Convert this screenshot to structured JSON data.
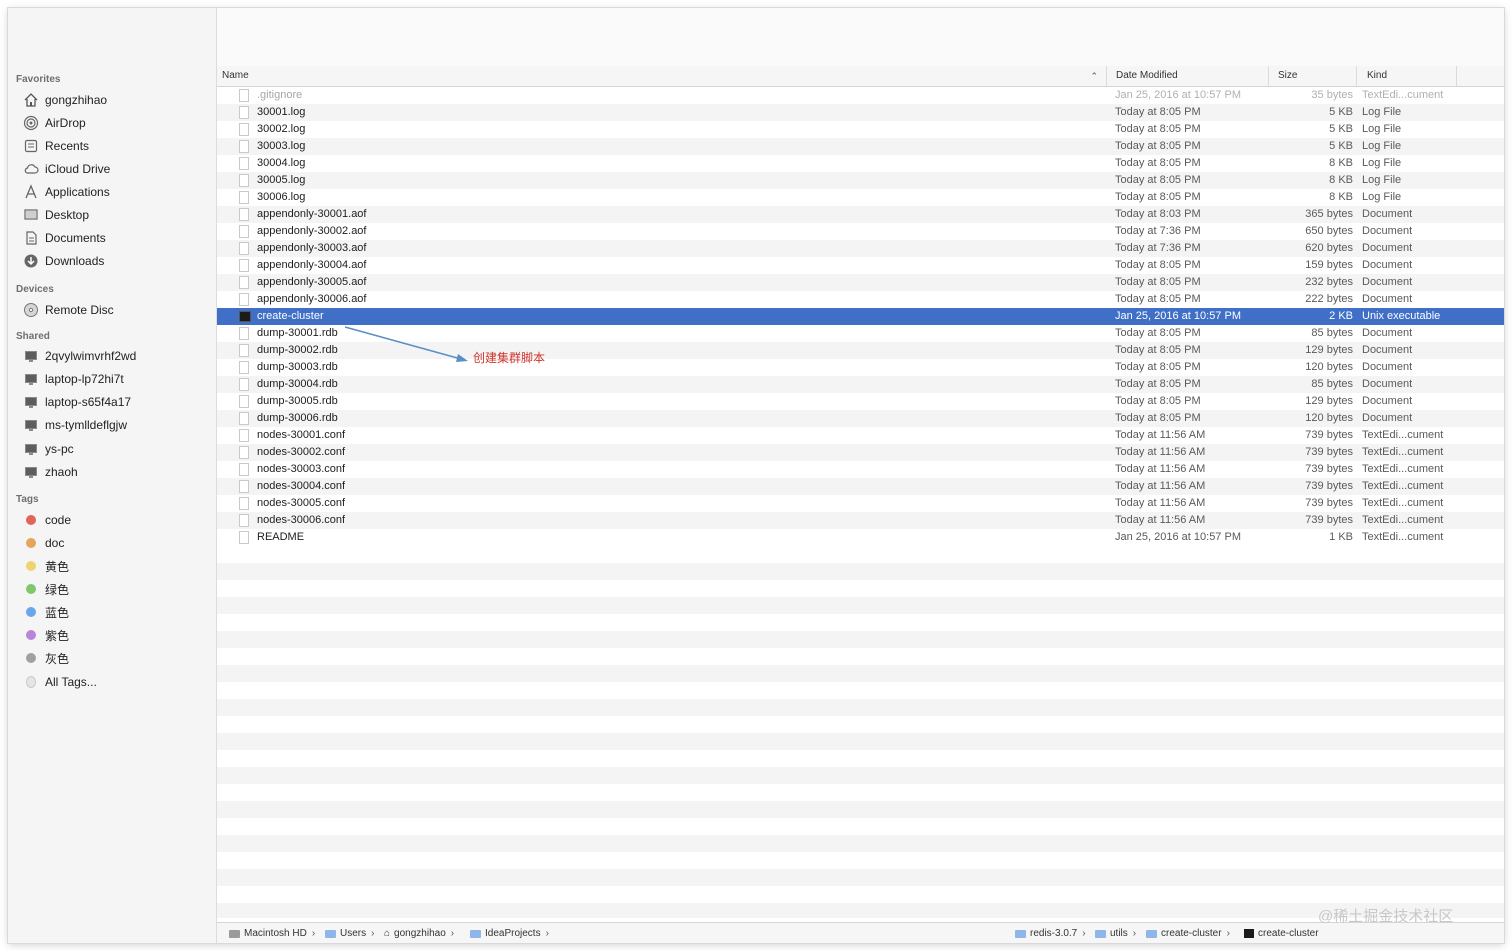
{
  "sidebar": {
    "sections": {
      "favorites": "Favorites",
      "devices": "Devices",
      "shared": "Shared",
      "tags": "Tags"
    },
    "favorites": [
      {
        "label": "gongzhihao",
        "icon": "home-icon"
      },
      {
        "label": "AirDrop",
        "icon": "airdrop-icon"
      },
      {
        "label": "Recents",
        "icon": "recents-icon"
      },
      {
        "label": "iCloud Drive",
        "icon": "cloud-icon"
      },
      {
        "label": "Applications",
        "icon": "applications-icon"
      },
      {
        "label": "Desktop",
        "icon": "desktop-icon"
      },
      {
        "label": "Documents",
        "icon": "documents-icon"
      },
      {
        "label": "Downloads",
        "icon": "downloads-icon"
      }
    ],
    "devices": [
      {
        "label": "Remote Disc",
        "icon": "disc-icon"
      }
    ],
    "shared": [
      {
        "label": "2qvylwimvrhf2wd",
        "icon": "computer-icon"
      },
      {
        "label": "laptop-lp72hi7t",
        "icon": "computer-icon"
      },
      {
        "label": "laptop-s65f4a17",
        "icon": "computer-icon"
      },
      {
        "label": "ms-tymlldeflgjw",
        "icon": "computer-icon"
      },
      {
        "label": "ys-pc",
        "icon": "computer-icon"
      },
      {
        "label": "zhaoh",
        "icon": "computer-icon"
      }
    ],
    "tags": [
      {
        "label": "code",
        "color": "#e0655c"
      },
      {
        "label": "doc",
        "color": "#e5a55b"
      },
      {
        "label": "黄色",
        "color": "#efd372"
      },
      {
        "label": "绿色",
        "color": "#7fc86a"
      },
      {
        "label": "蓝色",
        "color": "#69a7ea"
      },
      {
        "label": "紫色",
        "color": "#b985d9"
      },
      {
        "label": "灰色",
        "color": "#a0a0a0"
      },
      {
        "label": "All Tags...",
        "color": "#e5e5e5"
      }
    ]
  },
  "columns": {
    "name": "Name",
    "date": "Date Modified",
    "size": "Size",
    "kind": "Kind"
  },
  "files": [
    {
      "name": ".gitignore",
      "date": "Jan 25, 2016 at 10:57 PM",
      "size": "35 bytes",
      "kind": "TextEdi...cument",
      "state": "dim"
    },
    {
      "name": "30001.log",
      "date": "Today at 8:05 PM",
      "size": "5 KB",
      "kind": "Log File"
    },
    {
      "name": "30002.log",
      "date": "Today at 8:05 PM",
      "size": "5 KB",
      "kind": "Log File"
    },
    {
      "name": "30003.log",
      "date": "Today at 8:05 PM",
      "size": "5 KB",
      "kind": "Log File"
    },
    {
      "name": "30004.log",
      "date": "Today at 8:05 PM",
      "size": "8 KB",
      "kind": "Log File"
    },
    {
      "name": "30005.log",
      "date": "Today at 8:05 PM",
      "size": "8 KB",
      "kind": "Log File"
    },
    {
      "name": "30006.log",
      "date": "Today at 8:05 PM",
      "size": "8 KB",
      "kind": "Log File"
    },
    {
      "name": "appendonly-30001.aof",
      "date": "Today at 8:03 PM",
      "size": "365 bytes",
      "kind": "Document"
    },
    {
      "name": "appendonly-30002.aof",
      "date": "Today at 7:36 PM",
      "size": "650 bytes",
      "kind": "Document"
    },
    {
      "name": "appendonly-30003.aof",
      "date": "Today at 7:36 PM",
      "size": "620 bytes",
      "kind": "Document"
    },
    {
      "name": "appendonly-30004.aof",
      "date": "Today at 8:05 PM",
      "size": "159 bytes",
      "kind": "Document"
    },
    {
      "name": "appendonly-30005.aof",
      "date": "Today at 8:05 PM",
      "size": "232 bytes",
      "kind": "Document"
    },
    {
      "name": "appendonly-30006.aof",
      "date": "Today at 8:05 PM",
      "size": "222 bytes",
      "kind": "Document"
    },
    {
      "name": "create-cluster",
      "date": "Jan 25, 2016 at 10:57 PM",
      "size": "2 KB",
      "kind": "Unix executable",
      "state": "selected",
      "icon": "exe"
    },
    {
      "name": "dump-30001.rdb",
      "date": "Today at 8:05 PM",
      "size": "85 bytes",
      "kind": "Document"
    },
    {
      "name": "dump-30002.rdb",
      "date": "Today at 8:05 PM",
      "size": "129 bytes",
      "kind": "Document"
    },
    {
      "name": "dump-30003.rdb",
      "date": "Today at 8:05 PM",
      "size": "120 bytes",
      "kind": "Document"
    },
    {
      "name": "dump-30004.rdb",
      "date": "Today at 8:05 PM",
      "size": "85 bytes",
      "kind": "Document"
    },
    {
      "name": "dump-30005.rdb",
      "date": "Today at 8:05 PM",
      "size": "129 bytes",
      "kind": "Document"
    },
    {
      "name": "dump-30006.rdb",
      "date": "Today at 8:05 PM",
      "size": "120 bytes",
      "kind": "Document"
    },
    {
      "name": "nodes-30001.conf",
      "date": "Today at 11:56 AM",
      "size": "739 bytes",
      "kind": "TextEdi...cument"
    },
    {
      "name": "nodes-30002.conf",
      "date": "Today at 11:56 AM",
      "size": "739 bytes",
      "kind": "TextEdi...cument"
    },
    {
      "name": "nodes-30003.conf",
      "date": "Today at 11:56 AM",
      "size": "739 bytes",
      "kind": "TextEdi...cument"
    },
    {
      "name": "nodes-30004.conf",
      "date": "Today at 11:56 AM",
      "size": "739 bytes",
      "kind": "TextEdi...cument"
    },
    {
      "name": "nodes-30005.conf",
      "date": "Today at 11:56 AM",
      "size": "739 bytes",
      "kind": "TextEdi...cument"
    },
    {
      "name": "nodes-30006.conf",
      "date": "Today at 11:56 AM",
      "size": "739 bytes",
      "kind": "TextEdi...cument"
    },
    {
      "name": "README",
      "date": "Jan 25, 2016 at 10:57 PM",
      "size": "1 KB",
      "kind": "TextEdi...cument"
    }
  ],
  "annotation": {
    "text": "创建集群脚本",
    "color": "#d0342c"
  },
  "pathbar": {
    "left": [
      {
        "label": "Macintosh HD",
        "icon": "hd"
      },
      {
        "label": "Users",
        "icon": "folder"
      },
      {
        "label": "gongzhihao",
        "icon": "home"
      },
      {
        "label": "IdeaProjects",
        "icon": "folder"
      }
    ],
    "right": [
      {
        "label": "redis-3.0.7",
        "icon": "folder"
      },
      {
        "label": "utils",
        "icon": "folder"
      },
      {
        "label": "create-cluster",
        "icon": "folder"
      },
      {
        "label": "create-cluster",
        "icon": "exe"
      }
    ]
  },
  "watermark": "@稀土掘金技术社区",
  "colors": {
    "selection": "#3f6fc6",
    "sidebar": "#f5f5f5"
  }
}
